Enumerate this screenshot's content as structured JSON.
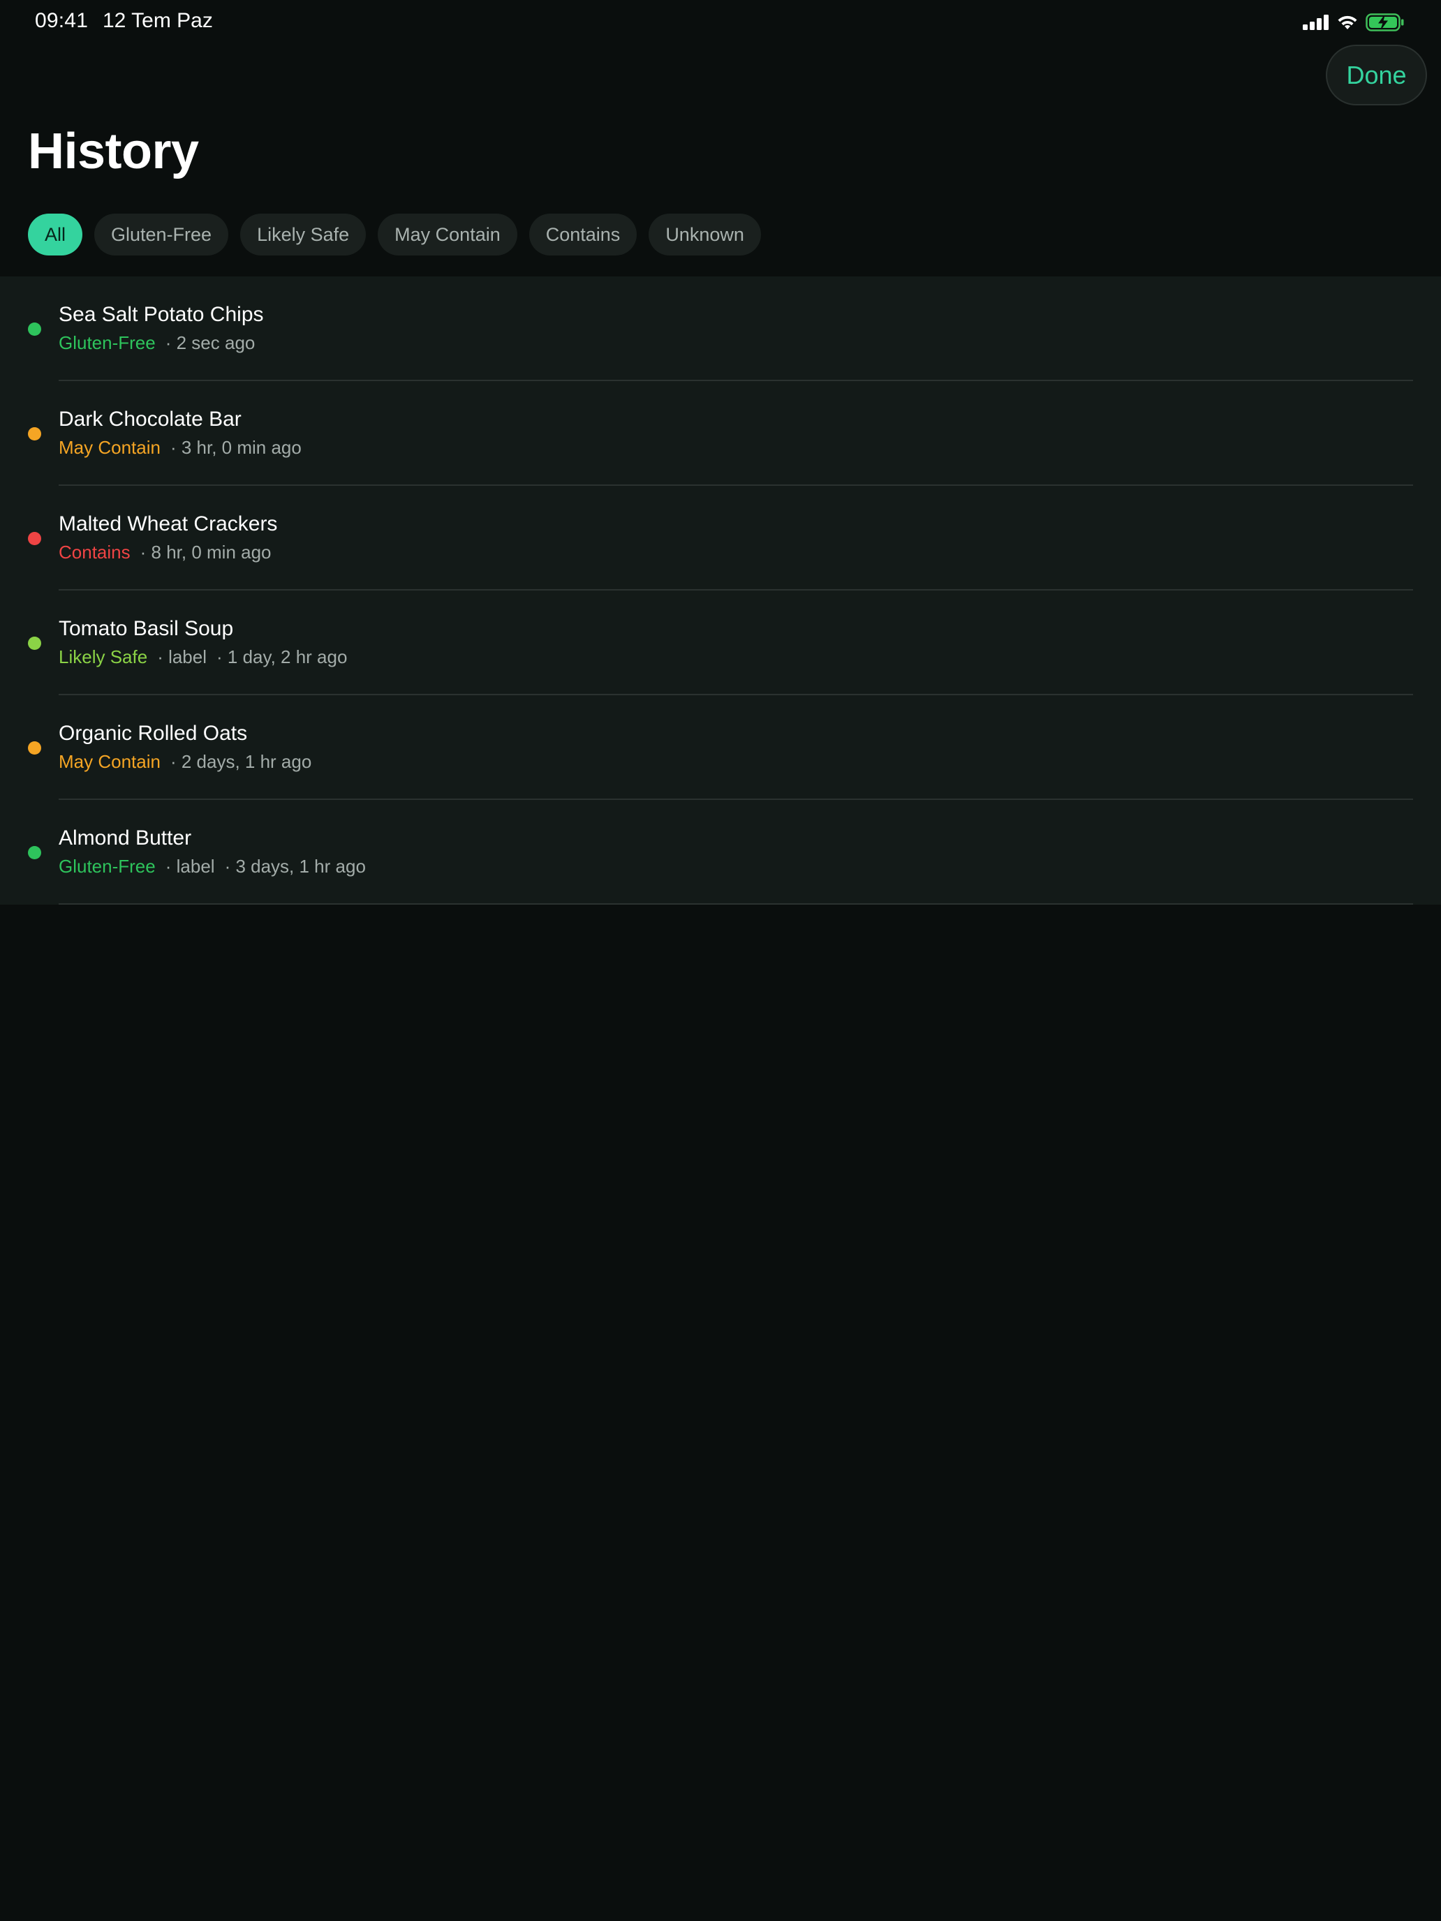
{
  "status_bar": {
    "time": "09:41",
    "date": "12 Tem Paz",
    "icons": [
      "cellular-signal-icon",
      "wifi-icon",
      "battery-charging-icon"
    ]
  },
  "header": {
    "done_label": "Done",
    "title": "History"
  },
  "filters": [
    {
      "label": "All",
      "active": true
    },
    {
      "label": "Gluten-Free",
      "active": false
    },
    {
      "label": "Likely Safe",
      "active": false
    },
    {
      "label": "May Contain",
      "active": false
    },
    {
      "label": "Contains",
      "active": false
    },
    {
      "label": "Unknown",
      "active": false
    }
  ],
  "colors": {
    "accent": "#34d39e",
    "gluten_free": "#22c55e",
    "likely_safe": "#84cc16",
    "may_contain": "#f5a524",
    "contains": "#ef4444"
  },
  "history": [
    {
      "name": "Sea Salt Potato Chips",
      "status": "Gluten-Free",
      "status_color": "#2ec35c",
      "extra": "",
      "time": "· 2 sec ago"
    },
    {
      "name": "Dark Chocolate Bar",
      "status": "May Contain",
      "status_color": "#f5a524",
      "extra": "",
      "time": "· 3 hr, 0 min ago"
    },
    {
      "name": "Malted Wheat Crackers",
      "status": "Contains",
      "status_color": "#ef4444",
      "extra": "",
      "time": "· 8 hr, 0 min ago"
    },
    {
      "name": "Tomato Basil Soup",
      "status": "Likely Safe",
      "status_color": "#8bd346",
      "extra": "· label",
      "time": "· 1 day, 2 hr ago"
    },
    {
      "name": "Organic Rolled Oats",
      "status": "May Contain",
      "status_color": "#f5a524",
      "extra": "",
      "time": "· 2 days, 1 hr ago"
    },
    {
      "name": "Almond Butter",
      "status": "Gluten-Free",
      "status_color": "#2ec35c",
      "extra": "· label",
      "time": "· 3 days, 1 hr ago"
    }
  ]
}
